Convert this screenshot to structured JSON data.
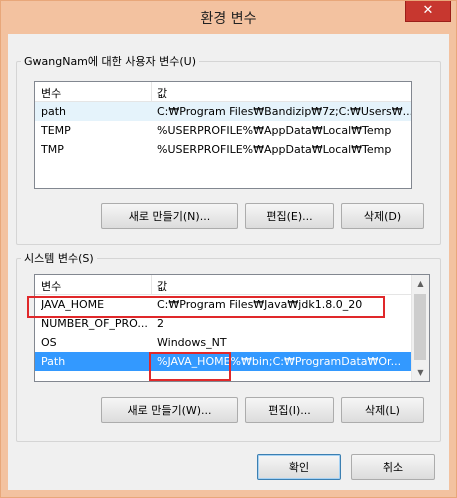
{
  "window": {
    "title": "환경 변수",
    "close_glyph": "✕"
  },
  "user_vars": {
    "group_label": "GwangNam에 대한 사용자 변수(U)",
    "columns": [
      "변수",
      "값"
    ],
    "rows": [
      {
        "name": "path",
        "value": "C:₩Program Files₩Bandizip₩7z;C:₩Users₩..."
      },
      {
        "name": "TEMP",
        "value": "%USERPROFILE%₩AppData₩Local₩Temp"
      },
      {
        "name": "TMP",
        "value": "%USERPROFILE%₩AppData₩Local₩Temp"
      }
    ],
    "buttons": {
      "new": "새로 만들기(N)...",
      "edit": "편집(E)...",
      "delete": "삭제(D)"
    }
  },
  "system_vars": {
    "group_label": "시스템 변수(S)",
    "columns": [
      "변수",
      "값"
    ],
    "rows": [
      {
        "name": "JAVA_HOME",
        "value": "C:₩Program Files₩Java₩jdk1.8.0_20"
      },
      {
        "name": "NUMBER_OF_PRO...",
        "value": "2"
      },
      {
        "name": "OS",
        "value": "Windows_NT"
      },
      {
        "name": "Path",
        "value": "%JAVA_HOME%₩bin;C:₩ProgramData₩Or..."
      }
    ],
    "buttons": {
      "new": "새로 만들기(W)...",
      "edit": "편집(I)...",
      "delete": "삭제(L)"
    }
  },
  "dialog_buttons": {
    "ok": "확인",
    "cancel": "취소"
  },
  "colors": {
    "selection": "#3399ff",
    "highlight_box": "#e0282a",
    "titlebar": "#f3c2a0",
    "close": "#c7372f"
  }
}
